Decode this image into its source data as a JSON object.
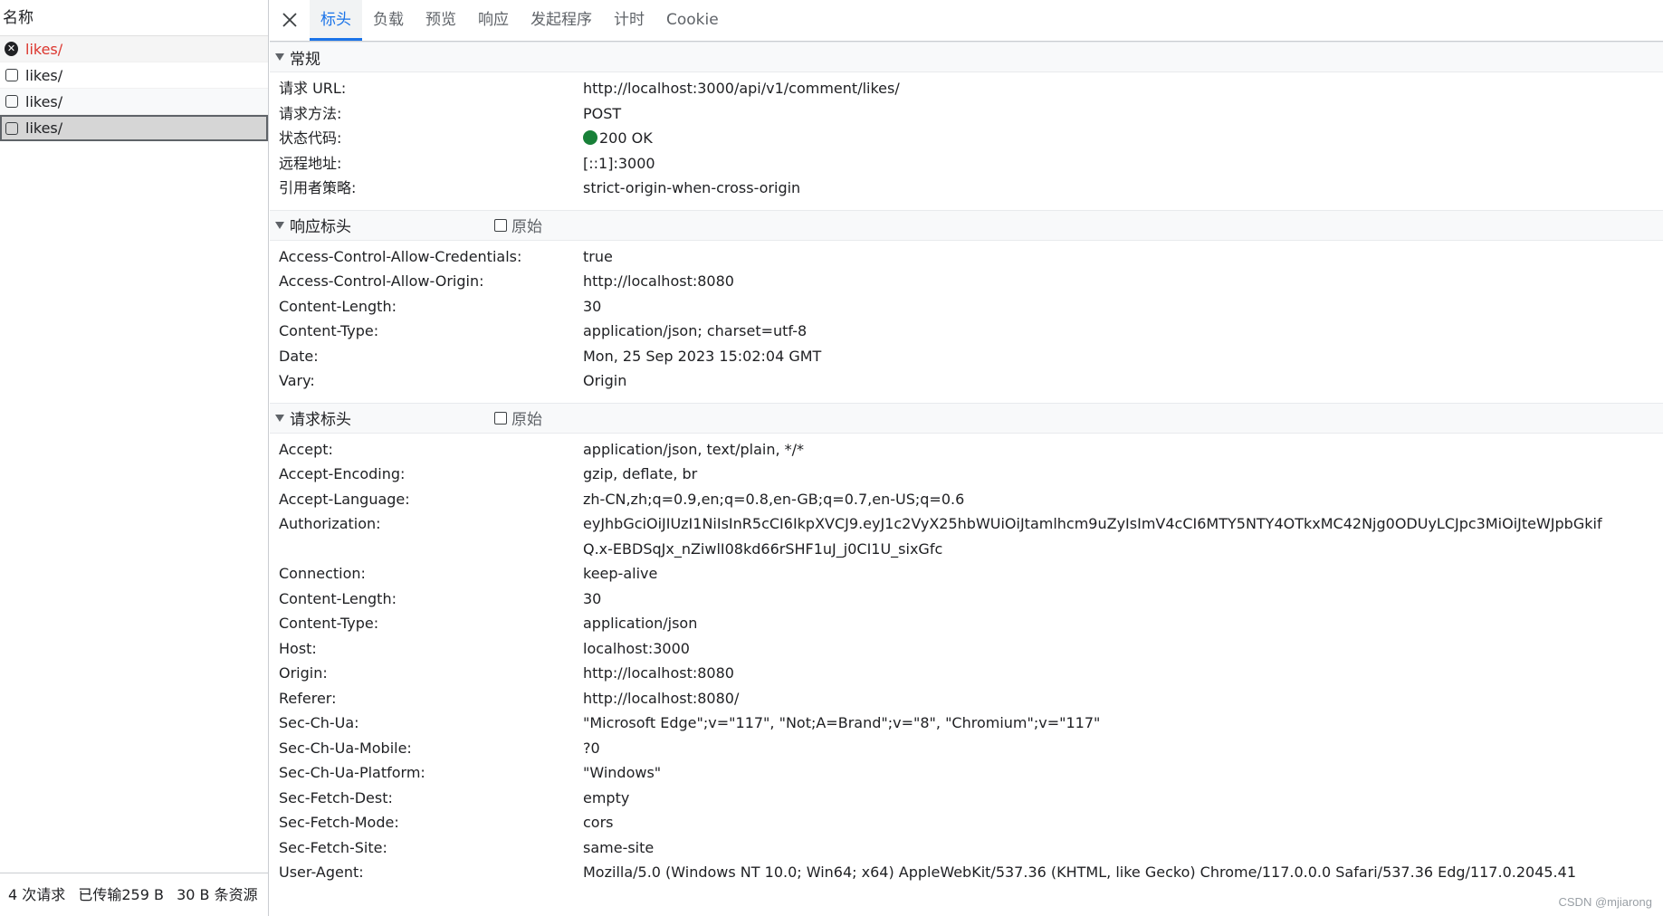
{
  "left": {
    "header": "名称",
    "requests": [
      {
        "label": "likes/",
        "state": "error"
      },
      {
        "label": "likes/",
        "state": "normal"
      },
      {
        "label": "likes/",
        "state": "normal"
      },
      {
        "label": "likes/",
        "state": "selected"
      }
    ],
    "status": {
      "count": "4 次请求",
      "transferred": "已传输259 B",
      "resources": "30 B 条资源"
    }
  },
  "tabs": [
    {
      "label": "标头",
      "active": true
    },
    {
      "label": "负载"
    },
    {
      "label": "预览"
    },
    {
      "label": "响应"
    },
    {
      "label": "发起程序"
    },
    {
      "label": "计时"
    },
    {
      "label": "Cookie"
    }
  ],
  "sections": {
    "general": {
      "title": "常规",
      "rows": [
        {
          "k": "请求 URL:",
          "v": "http://localhost:3000/api/v1/comment/likes/"
        },
        {
          "k": "请求方法:",
          "v": "POST"
        },
        {
          "k": "状态代码:",
          "v": "200 OK"
        },
        {
          "k": "远程地址:",
          "v": "[::1]:3000"
        },
        {
          "k": "引用者策略:",
          "v": "strict-origin-when-cross-origin"
        }
      ]
    },
    "response": {
      "title": "响应标头",
      "raw_label": "原始",
      "rows": [
        {
          "k": "Access-Control-Allow-Credentials:",
          "v": "true"
        },
        {
          "k": "Access-Control-Allow-Origin:",
          "v": "http://localhost:8080"
        },
        {
          "k": "Content-Length:",
          "v": "30"
        },
        {
          "k": "Content-Type:",
          "v": "application/json; charset=utf-8"
        },
        {
          "k": "Date:",
          "v": "Mon, 25 Sep 2023 15:02:04 GMT"
        },
        {
          "k": "Vary:",
          "v": "Origin"
        }
      ]
    },
    "request": {
      "title": "请求标头",
      "raw_label": "原始",
      "rows": [
        {
          "k": "Accept:",
          "v": "application/json, text/plain, */*"
        },
        {
          "k": "Accept-Encoding:",
          "v": "gzip, deflate, br"
        },
        {
          "k": "Accept-Language:",
          "v": "zh-CN,zh;q=0.9,en;q=0.8,en-GB;q=0.7,en-US;q=0.6"
        },
        {
          "k": "Authorization:",
          "v": "eyJhbGciOiJIUzI1NiIsInR5cCI6IkpXVCJ9.eyJ1c2VyX25hbWUiOiJtamlhcm9uZyIsImV4cCI6MTY5NTY4OTkxMC42Njg0ODUyLCJpc3MiOiJteWJpbGkifQ.x-EBDSqJx_nZiwlI08kd66rSHF1uJ_j0CI1U_sixGfc"
        },
        {
          "k": "Connection:",
          "v": "keep-alive"
        },
        {
          "k": "Content-Length:",
          "v": "30"
        },
        {
          "k": "Content-Type:",
          "v": "application/json"
        },
        {
          "k": "Host:",
          "v": "localhost:3000"
        },
        {
          "k": "Origin:",
          "v": "http://localhost:8080"
        },
        {
          "k": "Referer:",
          "v": "http://localhost:8080/"
        },
        {
          "k": "Sec-Ch-Ua:",
          "v": "\"Microsoft Edge\";v=\"117\", \"Not;A=Brand\";v=\"8\", \"Chromium\";v=\"117\""
        },
        {
          "k": "Sec-Ch-Ua-Mobile:",
          "v": "?0"
        },
        {
          "k": "Sec-Ch-Ua-Platform:",
          "v": "\"Windows\""
        },
        {
          "k": "Sec-Fetch-Dest:",
          "v": "empty"
        },
        {
          "k": "Sec-Fetch-Mode:",
          "v": "cors"
        },
        {
          "k": "Sec-Fetch-Site:",
          "v": "same-site"
        },
        {
          "k": "User-Agent:",
          "v": "Mozilla/5.0 (Windows NT 10.0; Win64; x64) AppleWebKit/537.36 (KHTML, like Gecko) Chrome/117.0.0.0 Safari/537.36 Edg/117.0.2045.41"
        }
      ]
    }
  },
  "watermark": "CSDN @mjiarong",
  "colors": {
    "accent": "#1a73e8",
    "error": "#dc362e",
    "ok": "#188038"
  }
}
